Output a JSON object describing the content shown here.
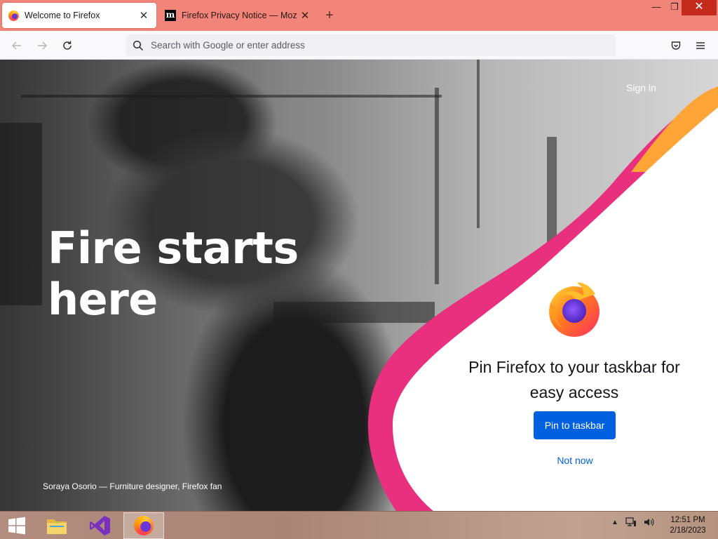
{
  "tabs": [
    {
      "title": "Welcome to Firefox",
      "active": true,
      "favicon": "firefox-icon"
    },
    {
      "title": "Firefox Privacy Notice — Mozilla",
      "active": false,
      "favicon": "mozilla-m-icon"
    }
  ],
  "window_controls": {
    "minimize": "—",
    "maximize": "❐",
    "close": "✕"
  },
  "urlbar": {
    "placeholder": "Search with Google or enter address",
    "value": ""
  },
  "content": {
    "sign_in": "Sign in",
    "headline": "Fire starts here",
    "caption": "Soraya Osorio — Furniture designer, Firefox fan",
    "pin_title": "Pin Firefox to your taskbar for easy access",
    "pin_button": "Pin to taskbar",
    "not_now": "Not now"
  },
  "taskbar": {
    "apps": [
      "windows-start",
      "file-explorer",
      "visual-studio",
      "firefox"
    ],
    "clock_time": "12:51 PM",
    "clock_date": "2/18/2023"
  },
  "colors": {
    "tabstrip": "#f1857a",
    "accent_blue": "#0061e0",
    "swoosh_pink": "#e8307f",
    "swoosh_orange": "#ffa436"
  }
}
